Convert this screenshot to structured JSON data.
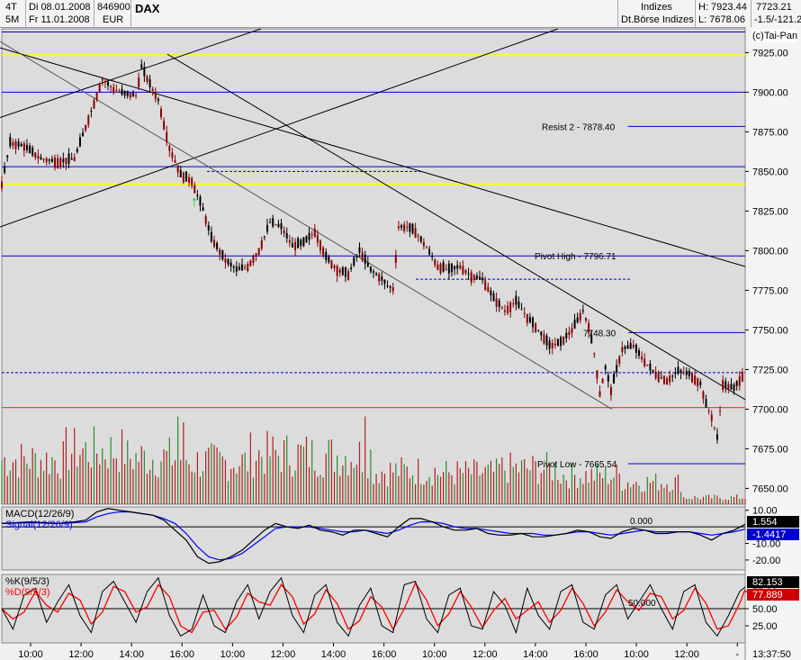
{
  "header": {
    "tf1": "4T",
    "tf2": "5M",
    "date_from": "Di 08.01.2008",
    "date_to": "Fr 11.01.2008",
    "wkn": "846900",
    "currency": "EUR",
    "symbol": "DAX",
    "category": "Indizes",
    "exchange": "Dt.Börse Indizes",
    "high": "H: 7923.44",
    "low": "L: 7678.06",
    "last": "7723.21",
    "change": "-1.5/-121.2",
    "copyright": "(c)Tai-Pan"
  },
  "colors": {
    "background": "#dcdcdc",
    "up_candle": "#8b0000",
    "down_candle": "#000000",
    "horizontal_blue": "#0000cc",
    "yellow_line": "#ffff00",
    "red_line": "#ff4040",
    "macd": "#000000",
    "signal": "#0000ff",
    "stoch_k": "#000000",
    "stoch_d": "#ff0000"
  },
  "chart_data": [
    {
      "type": "candlestick",
      "title": "DAX",
      "ylim": [
        7640,
        7940
      ],
      "yticks": [
        "7650.00",
        "7675.00",
        "7700.00",
        "7725.00",
        "7750.00",
        "7775.00",
        "7800.00",
        "7825.00",
        "7850.00",
        "7875.00",
        "7900.00",
        "7925.00"
      ],
      "xticks": [
        "10:00",
        "12:00",
        "14:00",
        "16:00",
        "10:00",
        "12:00",
        "14:00",
        "16:00",
        "10:00",
        "12:00",
        "14:00",
        "16:00",
        "10:00",
        "12:00",
        "-"
      ],
      "time_readout": "13:37:50",
      "annotations": [
        "Resist 2 - 7878.40",
        "Pivot High - 7796.71",
        "7748.30",
        "Pivot Low - 7665.54"
      ],
      "levels": {
        "resist2": 7878.4,
        "pivot_high": 7796.71,
        "mid": 7748.3,
        "pivot_low": 7665.54,
        "yellow_top": 7923.4,
        "yellow_bottom": 7842,
        "blue_1900": 7900,
        "blue_7853": 7853,
        "blue_7723": 7723,
        "red_7701": 7701,
        "blue_top": 7938
      },
      "close_points": [
        [
          0,
          7842
        ],
        [
          3,
          7868
        ],
        [
          8,
          7866
        ],
        [
          14,
          7858
        ],
        [
          20,
          7856
        ],
        [
          26,
          7858
        ],
        [
          30,
          7878
        ],
        [
          36,
          7908
        ],
        [
          40,
          7902
        ],
        [
          44,
          7899
        ],
        [
          48,
          7898
        ],
        [
          50,
          7916
        ],
        [
          53,
          7905
        ],
        [
          56,
          7895
        ],
        [
          60,
          7865
        ],
        [
          64,
          7848
        ],
        [
          68,
          7844
        ],
        [
          72,
          7826
        ],
        [
          75,
          7808
        ],
        [
          80,
          7794
        ],
        [
          84,
          7788
        ],
        [
          88,
          7790
        ],
        [
          92,
          7800
        ],
        [
          96,
          7818
        ],
        [
          100,
          7815
        ],
        [
          104,
          7803
        ],
        [
          108,
          7805
        ],
        [
          112,
          7812
        ],
        [
          116,
          7796
        ],
        [
          120,
          7788
        ],
        [
          124,
          7785
        ],
        [
          128,
          7800
        ],
        [
          132,
          7788
        ],
        [
          136,
          7782
        ],
        [
          138,
          7778
        ],
        [
          140,
          7776
        ],
        [
          142,
          7815
        ],
        [
          145,
          7815
        ],
        [
          148,
          7812
        ],
        [
          152,
          7802
        ],
        [
          156,
          7790
        ],
        [
          160,
          7788
        ],
        [
          164,
          7790
        ],
        [
          168,
          7784
        ],
        [
          172,
          7782
        ],
        [
          176,
          7770
        ],
        [
          180,
          7762
        ],
        [
          184,
          7768
        ],
        [
          188,
          7758
        ],
        [
          192,
          7750
        ],
        [
          196,
          7740
        ],
        [
          200,
          7742
        ],
        [
          204,
          7750
        ],
        [
          208,
          7762
        ],
        [
          210,
          7752
        ],
        [
          212,
          7735
        ],
        [
          214,
          7710
        ],
        [
          216,
          7726
        ],
        [
          218,
          7712
        ],
        [
          222,
          7738
        ],
        [
          226,
          7740
        ],
        [
          230,
          7730
        ],
        [
          234,
          7722
        ],
        [
          238,
          7718
        ],
        [
          242,
          7724
        ],
        [
          246,
          7722
        ],
        [
          250,
          7716
        ],
        [
          252,
          7703
        ],
        [
          254,
          7695
        ],
        [
          256,
          7682
        ],
        [
          258,
          7716
        ],
        [
          262,
          7713
        ],
        [
          266,
          7724
        ]
      ],
      "volume": {
        "ylim": [
          0,
          100
        ],
        "spike_values": [
          75,
          70,
          75
        ],
        "base_values": [
          40,
          48,
          42,
          38,
          45,
          44,
          30,
          28,
          32,
          26,
          20,
          6
        ]
      }
    },
    {
      "type": "line",
      "title": "MACD(12/26/9)",
      "series": [
        {
          "name": "MACD(12/26/9)",
          "color": "#000000"
        },
        {
          "name": "Signal(12/26/9)",
          "color": "#0000ff"
        }
      ],
      "ylim": [
        -26,
        12
      ],
      "yticks": [
        "10.00",
        "-10.00",
        "-20.00"
      ],
      "zero_label": "0.000",
      "value_macd": "1.554",
      "value_signal": "-1.4417",
      "macd": [
        [
          0,
          2
        ],
        [
          10,
          3
        ],
        [
          20,
          2
        ],
        [
          26,
          3
        ],
        [
          30,
          4
        ],
        [
          34,
          9
        ],
        [
          38,
          11
        ],
        [
          42,
          10
        ],
        [
          46,
          9
        ],
        [
          50,
          8
        ],
        [
          54,
          7
        ],
        [
          58,
          4
        ],
        [
          62,
          -2
        ],
        [
          66,
          -8
        ],
        [
          70,
          -18
        ],
        [
          74,
          -22
        ],
        [
          78,
          -21
        ],
        [
          82,
          -18
        ],
        [
          86,
          -14
        ],
        [
          90,
          -8
        ],
        [
          94,
          -2
        ],
        [
          98,
          2
        ],
        [
          102,
          0
        ],
        [
          106,
          -1
        ],
        [
          110,
          1
        ],
        [
          114,
          -2
        ],
        [
          118,
          -3
        ],
        [
          122,
          -5
        ],
        [
          126,
          -2
        ],
        [
          130,
          -2
        ],
        [
          134,
          -4
        ],
        [
          138,
          -6
        ],
        [
          142,
          0
        ],
        [
          146,
          5
        ],
        [
          150,
          5
        ],
        [
          154,
          3
        ],
        [
          158,
          0
        ],
        [
          162,
          -2
        ],
        [
          166,
          -2
        ],
        [
          170,
          -1
        ],
        [
          174,
          -4
        ],
        [
          178,
          -5
        ],
        [
          182,
          -5
        ],
        [
          186,
          -4
        ],
        [
          190,
          -6
        ],
        [
          194,
          -6
        ],
        [
          198,
          -5
        ],
        [
          202,
          -4
        ],
        [
          206,
          -2
        ],
        [
          210,
          -3
        ],
        [
          214,
          -6
        ],
        [
          218,
          -7
        ],
        [
          222,
          -3
        ],
        [
          226,
          -1
        ],
        [
          230,
          -2
        ],
        [
          234,
          -4
        ],
        [
          238,
          -4
        ],
        [
          242,
          -3
        ],
        [
          246,
          -3
        ],
        [
          250,
          -5
        ],
        [
          254,
          -8
        ],
        [
          258,
          -4
        ],
        [
          262,
          -2
        ],
        [
          266,
          1.5
        ]
      ],
      "signal": [
        [
          0,
          2
        ],
        [
          10,
          2.5
        ],
        [
          20,
          2
        ],
        [
          26,
          2.5
        ],
        [
          30,
          3
        ],
        [
          34,
          6
        ],
        [
          38,
          8
        ],
        [
          42,
          9
        ],
        [
          46,
          9
        ],
        [
          50,
          8
        ],
        [
          54,
          7
        ],
        [
          58,
          5
        ],
        [
          62,
          2
        ],
        [
          66,
          -4
        ],
        [
          70,
          -12
        ],
        [
          74,
          -18
        ],
        [
          78,
          -20
        ],
        [
          82,
          -19
        ],
        [
          86,
          -16
        ],
        [
          90,
          -11
        ],
        [
          94,
          -6
        ],
        [
          98,
          -1
        ],
        [
          102,
          0
        ],
        [
          106,
          0
        ],
        [
          110,
          0
        ],
        [
          114,
          -1
        ],
        [
          118,
          -2
        ],
        [
          122,
          -3
        ],
        [
          126,
          -3
        ],
        [
          130,
          -2
        ],
        [
          134,
          -3
        ],
        [
          138,
          -4
        ],
        [
          142,
          -2
        ],
        [
          146,
          1
        ],
        [
          150,
          3
        ],
        [
          154,
          3
        ],
        [
          158,
          2
        ],
        [
          162,
          0
        ],
        [
          166,
          -1
        ],
        [
          170,
          -1
        ],
        [
          174,
          -2
        ],
        [
          178,
          -3
        ],
        [
          182,
          -4
        ],
        [
          186,
          -4
        ],
        [
          190,
          -4
        ],
        [
          194,
          -5
        ],
        [
          198,
          -5
        ],
        [
          202,
          -4
        ],
        [
          206,
          -3
        ],
        [
          210,
          -3
        ],
        [
          214,
          -4
        ],
        [
          218,
          -5
        ],
        [
          222,
          -4
        ],
        [
          226,
          -3
        ],
        [
          230,
          -2
        ],
        [
          234,
          -3
        ],
        [
          238,
          -3
        ],
        [
          242,
          -3
        ],
        [
          246,
          -3
        ],
        [
          250,
          -4
        ],
        [
          254,
          -5
        ],
        [
          258,
          -4
        ],
        [
          262,
          -3
        ],
        [
          266,
          -1.4
        ]
      ]
    },
    {
      "type": "line",
      "title": "%K(9/5/3)",
      "series": [
        {
          "name": "%K(9/5/3)",
          "color": "#000000"
        },
        {
          "name": "%D(9/5/3)",
          "color": "#ff0000"
        }
      ],
      "ylim": [
        0,
        100
      ],
      "yticks": [
        "75.00",
        "50.00",
        "25.00"
      ],
      "mid_label": "50.000",
      "value_k": "82.153",
      "value_d": "77.889",
      "k": [
        [
          0,
          50
        ],
        [
          4,
          20
        ],
        [
          8,
          70
        ],
        [
          12,
          80
        ],
        [
          16,
          30
        ],
        [
          20,
          60
        ],
        [
          24,
          85
        ],
        [
          28,
          40
        ],
        [
          32,
          15
        ],
        [
          36,
          75
        ],
        [
          40,
          90
        ],
        [
          44,
          60
        ],
        [
          48,
          30
        ],
        [
          52,
          75
        ],
        [
          56,
          95
        ],
        [
          60,
          40
        ],
        [
          64,
          10
        ],
        [
          68,
          20
        ],
        [
          72,
          70
        ],
        [
          76,
          25
        ],
        [
          80,
          15
        ],
        [
          84,
          60
        ],
        [
          88,
          85
        ],
        [
          92,
          35
        ],
        [
          96,
          75
        ],
        [
          100,
          95
        ],
        [
          104,
          40
        ],
        [
          108,
          15
        ],
        [
          112,
          70
        ],
        [
          116,
          85
        ],
        [
          120,
          30
        ],
        [
          124,
          10
        ],
        [
          128,
          55
        ],
        [
          132,
          80
        ],
        [
          136,
          25
        ],
        [
          140,
          15
        ],
        [
          144,
          85
        ],
        [
          148,
          90
        ],
        [
          152,
          35
        ],
        [
          156,
          15
        ],
        [
          160,
          70
        ],
        [
          164,
          80
        ],
        [
          168,
          25
        ],
        [
          172,
          20
        ],
        [
          176,
          75
        ],
        [
          180,
          55
        ],
        [
          184,
          15
        ],
        [
          188,
          80
        ],
        [
          192,
          40
        ],
        [
          196,
          20
        ],
        [
          200,
          75
        ],
        [
          204,
          85
        ],
        [
          208,
          30
        ],
        [
          212,
          20
        ],
        [
          216,
          70
        ],
        [
          220,
          85
        ],
        [
          224,
          35
        ],
        [
          228,
          60
        ],
        [
          232,
          85
        ],
        [
          236,
          50
        ],
        [
          240,
          20
        ],
        [
          244,
          75
        ],
        [
          248,
          85
        ],
        [
          252,
          30
        ],
        [
          256,
          10
        ],
        [
          260,
          40
        ],
        [
          264,
          75
        ],
        [
          266,
          82
        ]
      ]
    }
  ]
}
